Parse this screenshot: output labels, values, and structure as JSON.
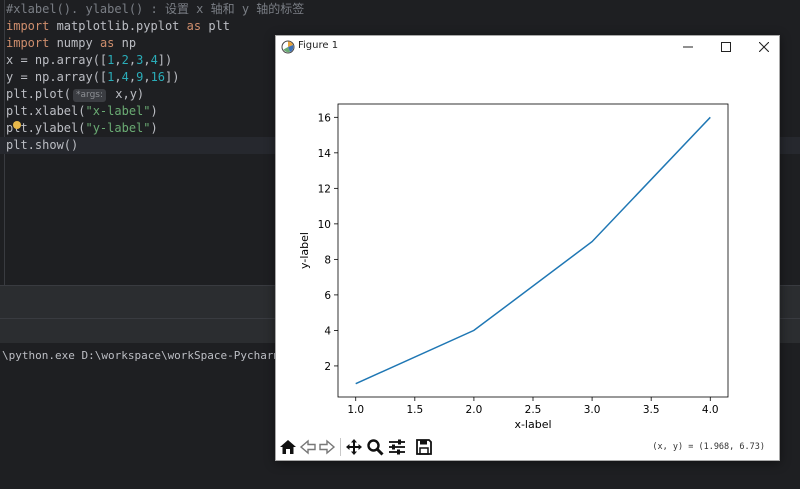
{
  "editor": {
    "comment": "#xlabel(). ylabel() : 设置 x 轴和 y 轴的标签",
    "lines": [
      {
        "kw": "import",
        "rest": " matplotlib.pyplot ",
        "kw2": "as",
        "rest2": " plt"
      },
      {
        "kw": "import",
        "rest": " numpy ",
        "kw2": "as",
        "rest2": " np"
      }
    ],
    "line_x": {
      "a": "x = np.array([",
      "n1": "1",
      "n2": "2",
      "n3": "3",
      "n4": "4",
      "z": "])"
    },
    "line_y": {
      "a": "y = np.array([",
      "n1": "1",
      "n2": "4",
      "n3": "9",
      "n4": "16",
      "z": "])"
    },
    "plot": {
      "a": "plt.plot(",
      "hint": "*args:",
      "b": " x,y)"
    },
    "xlabel": {
      "a": "plt.xlabel(",
      "s": "\"x-label\"",
      "b": ")"
    },
    "ylabel": {
      "a": "plt.ylabel(",
      "s": "\"y-label\"",
      "b": ")"
    },
    "show": "plt.show()"
  },
  "terminal": {
    "line": "\\python.exe D:\\workspace\\workSpace-Pycharm\\c"
  },
  "figure": {
    "title": "Figure 1",
    "coords": "(x, y) = (1.968, 6.73)",
    "icons": [
      "matplotlib-icon",
      "minimize-icon",
      "maximize-icon",
      "close-icon",
      "home-icon",
      "back-icon",
      "forward-icon",
      "pan-icon",
      "zoom-icon",
      "configure-icon",
      "save-icon"
    ]
  },
  "chart_data": {
    "type": "line",
    "x": [
      1,
      2,
      3,
      4
    ],
    "series": [
      {
        "values": [
          1,
          4,
          9,
          16
        ],
        "color": "#1f77b4"
      }
    ],
    "xlabel": "x-label",
    "ylabel": "y-label",
    "xlim": [
      0.85,
      4.15
    ],
    "ylim": [
      0.25,
      16.75
    ],
    "xticks": [
      1.0,
      1.5,
      2.0,
      2.5,
      3.0,
      3.5,
      4.0
    ],
    "xtick_labels": [
      "1.0",
      "1.5",
      "2.0",
      "2.5",
      "3.0",
      "3.5",
      "4.0"
    ],
    "yticks": [
      2,
      4,
      6,
      8,
      10,
      12,
      14,
      16
    ],
    "ytick_labels": [
      "2",
      "4",
      "6",
      "8",
      "10",
      "12",
      "14",
      "16"
    ],
    "grid": false
  }
}
